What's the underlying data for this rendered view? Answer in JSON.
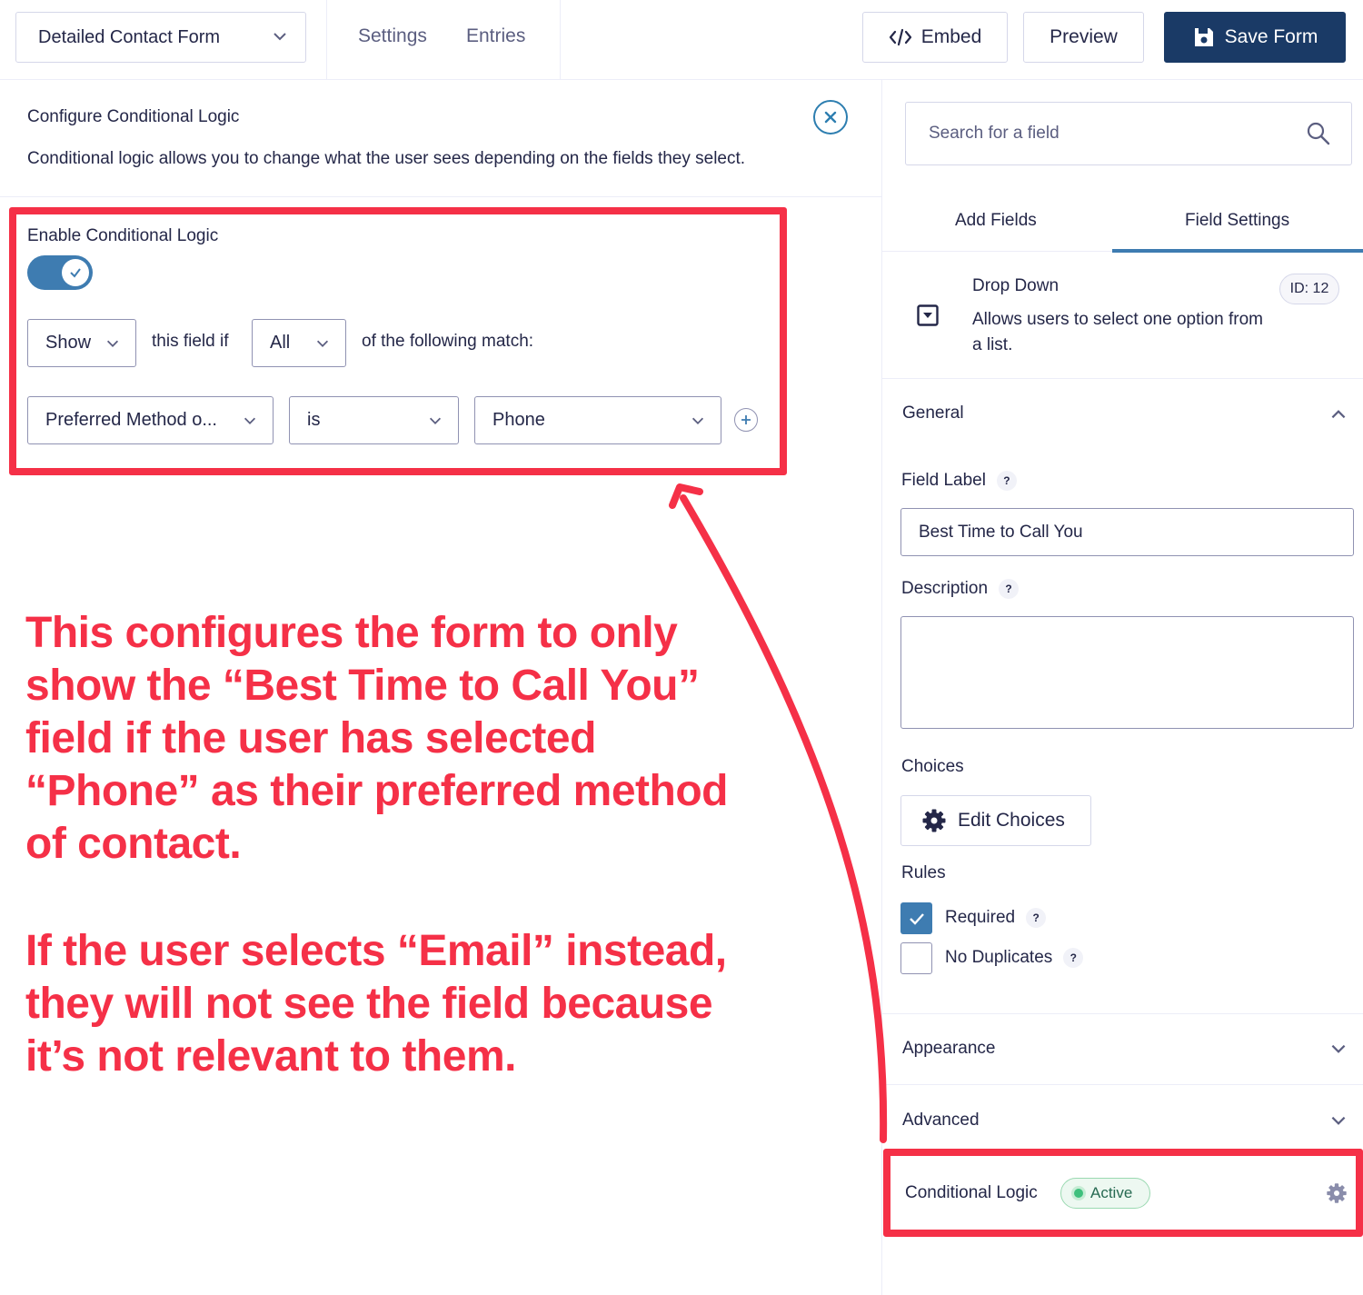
{
  "topbar": {
    "form_name": "Detailed Contact Form",
    "nav": [
      "Settings",
      "Entries"
    ],
    "embed_label": "Embed",
    "preview_label": "Preview",
    "save_label": "Save Form"
  },
  "conditional_panel": {
    "title": "Configure Conditional Logic",
    "description": "Conditional logic allows you to change what the user sees depending on the fields they select.",
    "enable_label": "Enable Conditional Logic",
    "enabled": true,
    "action": "Show",
    "this_field_if": "this field if",
    "match_type": "All",
    "following_match": "of the following match:",
    "rule": {
      "field": "Preferred Method o...",
      "operator": "is",
      "value": "Phone"
    }
  },
  "annotation": {
    "paragraph1": "This configures the form to only show the “Best Time to Call You” field if the user has selected “Phone” as their preferred method of contact.",
    "paragraph2": "If the user selects “Email” instead, they will not see the field because it’s not relevant to them."
  },
  "sidebar": {
    "search_placeholder": "Search for a field",
    "tabs": [
      "Add Fields",
      "Field Settings"
    ],
    "active_tab": "Field Settings",
    "field": {
      "type_title": "Drop Down",
      "type_desc": "Allows users to select one option from a list.",
      "id_badge": "ID: 12",
      "icon": "dropdown-field-icon"
    },
    "general": {
      "title": "General",
      "field_label_title": "Field Label",
      "field_label_value": "Best Time to Call You",
      "description_title": "Description",
      "description_value": "",
      "choices_title": "Choices",
      "edit_choices_label": "Edit Choices",
      "rules_title": "Rules",
      "required_label": "Required",
      "required_checked": true,
      "no_duplicates_label": "No Duplicates",
      "no_duplicates_checked": false,
      "help_glyph": "?"
    },
    "appearance_title": "Appearance",
    "advanced_title": "Advanced",
    "conditional_logic_title": "Conditional Logic",
    "conditional_logic_status": "Active"
  },
  "colors": {
    "annotation_red": "#f53047",
    "save_button_navy": "#1a3a66",
    "toggle_blue": "#3e7cb1",
    "active_green": "#3ec07d",
    "text_dark": "#242748"
  }
}
